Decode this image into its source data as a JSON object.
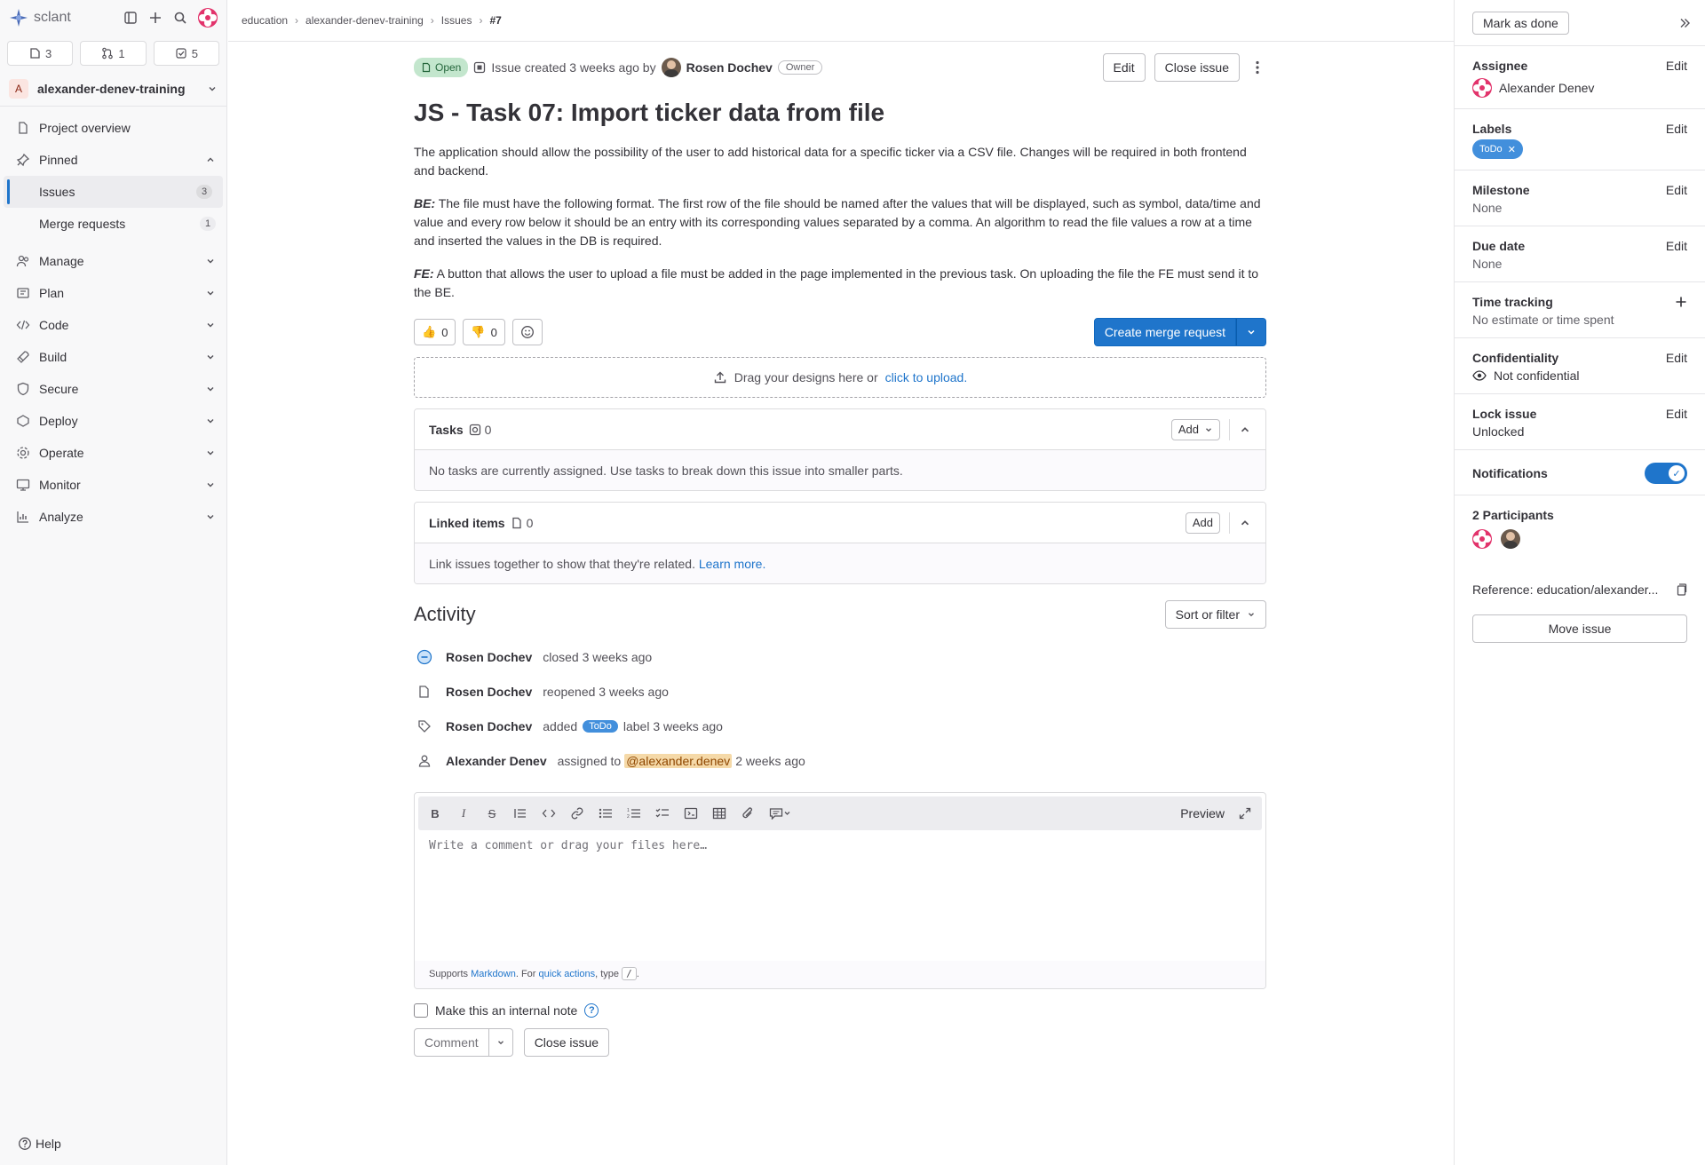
{
  "brand": {
    "name": "sclant"
  },
  "sidebar": {
    "counts": {
      "issues": "3",
      "merge_requests": "1",
      "todos": "5"
    },
    "project": {
      "initial": "A",
      "name": "alexander-denev-training"
    },
    "project_overview": "Project overview",
    "pinned": {
      "label": "Pinned",
      "items": [
        {
          "label": "Issues",
          "count": "3"
        },
        {
          "label": "Merge requests",
          "count": "1"
        }
      ]
    },
    "sections": [
      "Manage",
      "Plan",
      "Code",
      "Build",
      "Secure",
      "Deploy",
      "Operate",
      "Monitor",
      "Analyze"
    ],
    "help": "Help"
  },
  "breadcrumb": [
    "education",
    "alexander-denev-training",
    "Issues",
    "#7"
  ],
  "issue": {
    "status": "Open",
    "created_text": "Issue created 3 weeks ago by",
    "author": "Rosen Dochev",
    "author_role": "Owner",
    "edit_label": "Edit",
    "close_label": "Close issue",
    "title": "JS - Task 07: Import ticker data from file",
    "description": {
      "p1": "The application should allow the possibility of the user to add historical data for a specific ticker via a CSV file. Changes will be required in both frontend and backend.",
      "be_label": "BE:",
      "p2": " The file must have the following format. The first row of the file should be named after the values that will be displayed, such as symbol, data/time and value and every row below it should be an entry with its corresponding values separated by a comma. An algorithm to read the file values a row at a time and inserted the values in the DB is required.",
      "fe_label": "FE:",
      "p3": " A button that allows the user to upload a file must be added in the page implemented in the previous task. On uploading the file the FE must send it to the BE."
    },
    "reactions": {
      "thumbs_up": "0",
      "thumbs_down": "0"
    },
    "create_mr_label": "Create merge request",
    "dropzone": {
      "text": "Drag your designs here or",
      "link": "click to upload."
    },
    "tasks": {
      "title": "Tasks",
      "count": "0",
      "add": "Add",
      "empty": "No tasks are currently assigned. Use tasks to break down this issue into smaller parts."
    },
    "linked": {
      "title": "Linked items",
      "count": "0",
      "add": "Add",
      "empty": "Link issues together to show that they're related.",
      "learn_more": "Learn more."
    }
  },
  "activity": {
    "title": "Activity",
    "sort_label": "Sort or filter",
    "events": [
      {
        "user": "Rosen Dochev",
        "text": "closed 3 weeks ago"
      },
      {
        "user": "Rosen Dochev",
        "text": "reopened 3 weeks ago"
      },
      {
        "user": "Rosen Dochev",
        "pre": "added",
        "label": "ToDo",
        "post": "label 3 weeks ago"
      },
      {
        "user": "Alexander Denev",
        "pre": "assigned to",
        "mention": "@alexander.denev",
        "post": "2 weeks ago"
      }
    ]
  },
  "editor": {
    "preview": "Preview",
    "placeholder": "Write a comment or drag your files here…",
    "supports": "Supports",
    "markdown": "Markdown",
    "for_text": ". For",
    "quick_actions": "quick actions",
    "type_text": ", type",
    "slash": "/",
    "internal_note": "Make this an internal note",
    "comment_label": "Comment",
    "close_label": "Close issue"
  },
  "right_panel": {
    "mark_done": "Mark as done",
    "edit": "Edit",
    "assignee": {
      "title": "Assignee",
      "value": "Alexander Denev"
    },
    "labels": {
      "title": "Labels",
      "value": "ToDo"
    },
    "milestone": {
      "title": "Milestone",
      "value": "None"
    },
    "due_date": {
      "title": "Due date",
      "value": "None"
    },
    "time_tracking": {
      "title": "Time tracking",
      "value": "No estimate or time spent"
    },
    "confidentiality": {
      "title": "Confidentiality",
      "value": "Not confidential"
    },
    "lock": {
      "title": "Lock issue",
      "value": "Unlocked"
    },
    "notifications": {
      "title": "Notifications",
      "enabled": true
    },
    "participants": {
      "title": "2 Participants"
    },
    "reference": "Reference: education/alexander...",
    "move": "Move issue"
  },
  "colors": {
    "accent": "#1f75cb",
    "open_badge": "#c3e6cd",
    "label": "#428fdc",
    "avatar_pink": "#e2336b"
  }
}
